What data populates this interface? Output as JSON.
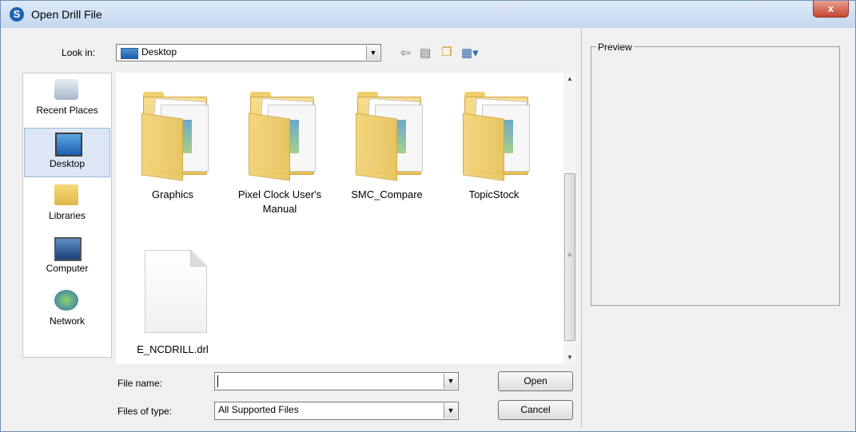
{
  "window": {
    "title": "Open Drill File",
    "close_label": "x"
  },
  "toolbar": {
    "look_in_label": "Look in:",
    "look_in_value": "Desktop"
  },
  "places": [
    {
      "label": "Recent Places",
      "icon": "recent-places-icon"
    },
    {
      "label": "Desktop",
      "icon": "desktop-icon",
      "selected": true
    },
    {
      "label": "Libraries",
      "icon": "libraries-icon"
    },
    {
      "label": "Computer",
      "icon": "computer-icon"
    },
    {
      "label": "Network",
      "icon": "network-icon"
    }
  ],
  "files": [
    {
      "name": "Graphics",
      "type": "folder"
    },
    {
      "name": "Pixel Clock User's Manual",
      "type": "folder"
    },
    {
      "name": "SMC_Compare",
      "type": "folder"
    },
    {
      "name": "TopicStock",
      "type": "folder"
    },
    {
      "name": "E_NCDRILL.drl",
      "type": "file"
    }
  ],
  "form": {
    "file_name_label": "File name:",
    "file_name_value": "",
    "file_type_label": "Files of type:",
    "file_type_value": "All Supported Files",
    "open_label": "Open",
    "cancel_label": "Cancel"
  },
  "preview": {
    "label": "Preview"
  }
}
